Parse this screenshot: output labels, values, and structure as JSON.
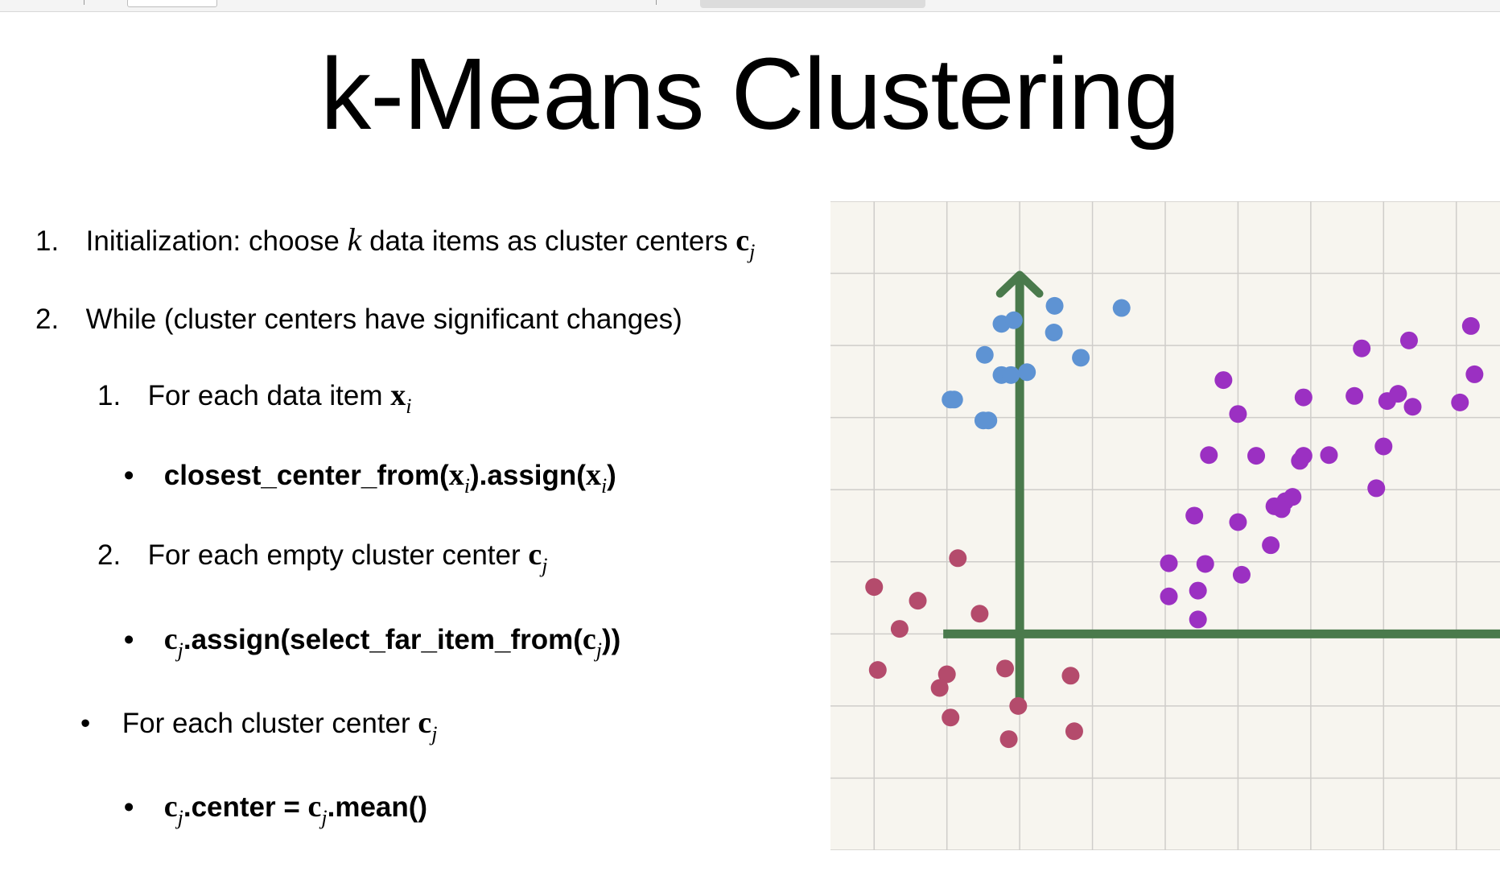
{
  "slide": {
    "title": "k-Means Clustering",
    "steps": {
      "s1": {
        "num": "1.",
        "text": "Initialization: choose ",
        "k": "k",
        "text2": " data items as cluster centers ",
        "c": "c",
        "sub": "j"
      },
      "s2": {
        "num": "2.",
        "text": "While (cluster centers have significant changes)"
      },
      "s2_1": {
        "num": "1.",
        "text": "For each data item ",
        "x": "x",
        "sub": "i"
      },
      "s2_1_b": {
        "bullet": "•",
        "p1": "closest_center_from(",
        "x1": "x",
        "sub1": "i",
        "p2": ").assign(",
        "x2": "x",
        "sub2": "i",
        "p3": ")"
      },
      "s2_2": {
        "num": "2.",
        "text": "For each empty cluster center ",
        "c": "c",
        "sub": "j"
      },
      "s2_2_b": {
        "bullet": "•",
        "c1": "c",
        "sub1": "j",
        "p1": ".assign(select_far_item_from(",
        "c2": "c",
        "sub2": "j",
        "p2": "))"
      },
      "s3": {
        "bullet": "•",
        "text": "For each cluster center ",
        "c": "c",
        "sub": "j"
      },
      "s3_b": {
        "bullet": "•",
        "c1": "c",
        "sub1": "j",
        "p1": ".center = ",
        "c2": "c",
        "sub2": "j",
        "p2": ".mean()"
      }
    }
  },
  "chart_data": {
    "type": "scatter",
    "title": "",
    "xlabel": "",
    "ylabel": "",
    "grid": true,
    "xlim": [
      -2.6,
      6.6
    ],
    "ylim": [
      -3.0,
      6.0
    ],
    "colors": {
      "background": "#f7f5ef",
      "grid": "#cfcdca",
      "axes": "#4a7a4c",
      "blue": "#5e93d3",
      "purple": "#9b30c2",
      "red": "#b44b6c"
    },
    "series": [
      {
        "color": "blue",
        "points": [
          [
            -0.25,
            4.3
          ],
          [
            -0.08,
            4.35
          ],
          [
            0.48,
            4.55
          ],
          [
            0.47,
            4.18
          ],
          [
            1.4,
            4.52
          ],
          [
            -0.48,
            3.87
          ],
          [
            -0.25,
            3.59
          ],
          [
            -0.12,
            3.59
          ],
          [
            0.1,
            3.63
          ],
          [
            0.84,
            3.83
          ],
          [
            -0.95,
            3.25
          ],
          [
            -0.9,
            3.25
          ],
          [
            -0.5,
            2.96
          ],
          [
            -0.43,
            2.96
          ]
        ]
      },
      {
        "color": "purple",
        "points": [
          [
            6.2,
            4.27
          ],
          [
            4.7,
            3.96
          ],
          [
            5.35,
            4.07
          ],
          [
            2.8,
            3.52
          ],
          [
            6.25,
            3.6
          ],
          [
            4.6,
            3.3
          ],
          [
            5.05,
            3.23
          ],
          [
            5.2,
            3.33
          ],
          [
            3.9,
            3.28
          ],
          [
            3.0,
            3.05
          ],
          [
            5.4,
            3.15
          ],
          [
            6.05,
            3.21
          ],
          [
            5.0,
            2.6
          ],
          [
            2.6,
            2.48
          ],
          [
            3.25,
            2.47
          ],
          [
            3.9,
            2.47
          ],
          [
            4.25,
            2.48
          ],
          [
            3.85,
            2.4
          ],
          [
            4.9,
            2.02
          ],
          [
            3.0,
            1.55
          ],
          [
            2.4,
            1.64
          ],
          [
            3.5,
            1.77
          ],
          [
            3.75,
            1.9
          ],
          [
            3.65,
            1.84
          ],
          [
            3.6,
            1.73
          ],
          [
            2.05,
            0.98
          ],
          [
            2.55,
            0.97
          ],
          [
            3.05,
            0.82
          ],
          [
            3.45,
            1.23
          ],
          [
            2.05,
            0.52
          ],
          [
            2.45,
            0.6
          ],
          [
            2.45,
            0.2
          ]
        ]
      },
      {
        "color": "red",
        "points": [
          [
            -0.85,
            1.05
          ],
          [
            -2.0,
            0.65
          ],
          [
            -1.4,
            0.46
          ],
          [
            -0.55,
            0.28
          ],
          [
            -1.65,
            0.07
          ],
          [
            -1.95,
            -0.5
          ],
          [
            -1.0,
            -0.56
          ],
          [
            -0.2,
            -0.48
          ],
          [
            0.7,
            -0.58
          ],
          [
            -1.1,
            -0.75
          ],
          [
            -0.02,
            -1.0
          ],
          [
            -0.95,
            -1.16
          ],
          [
            -0.15,
            -1.46
          ],
          [
            0.75,
            -1.35
          ]
        ]
      }
    ]
  }
}
